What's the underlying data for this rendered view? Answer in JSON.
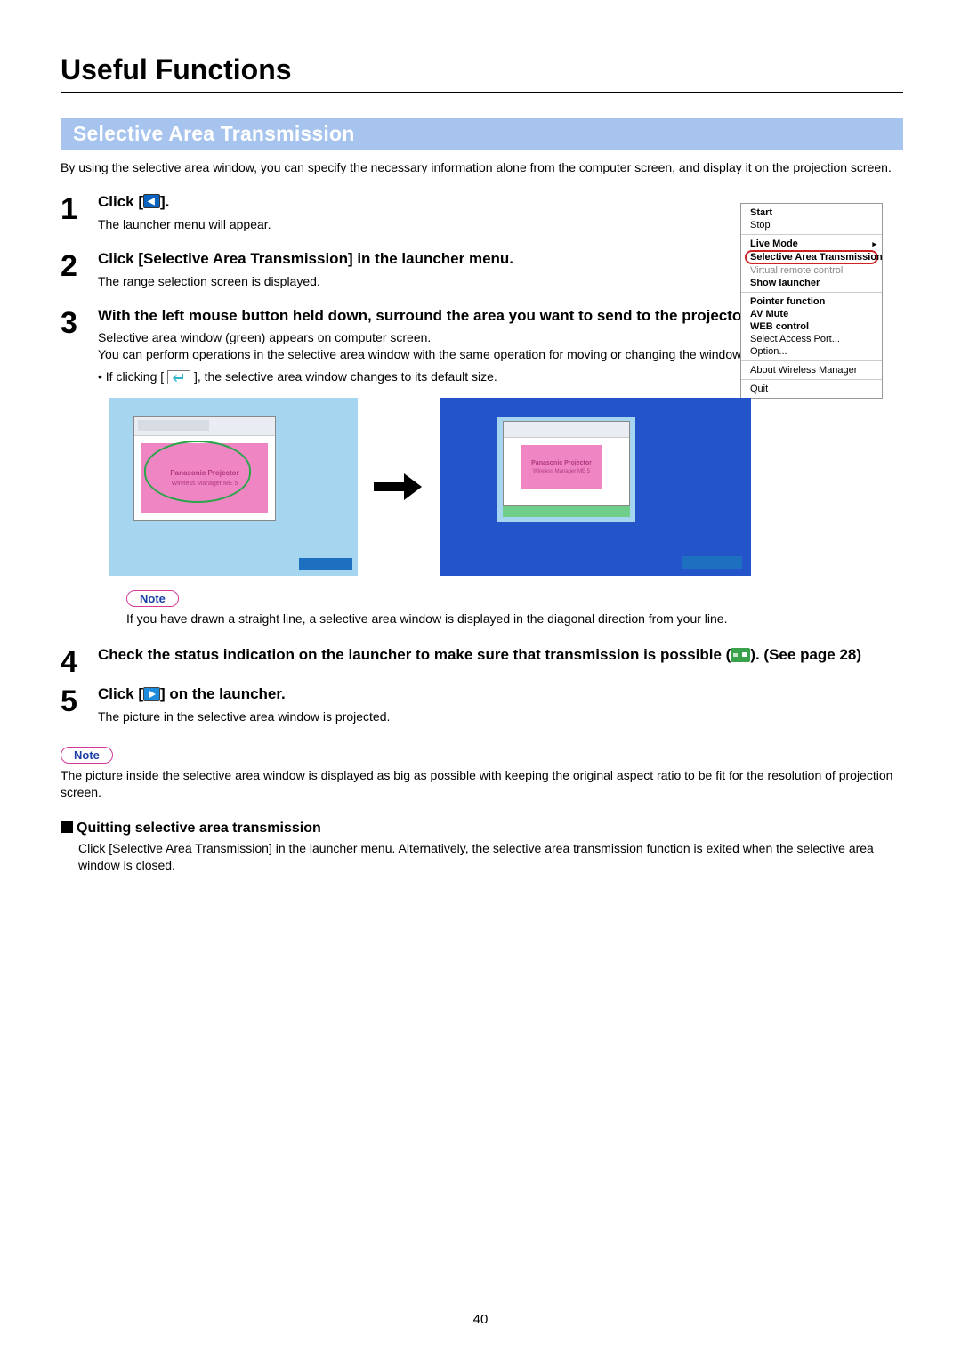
{
  "page": {
    "title": "Useful Functions",
    "section": "Selective Area Transmission",
    "intro": "By using the selective area window, you can specify the necessary information alone from the computer screen, and display it on the projection screen.",
    "page_number": "40"
  },
  "steps": {
    "s1": {
      "num": "1",
      "head_a": "Click [",
      "head_b": "].",
      "desc": "The launcher menu will appear."
    },
    "s2": {
      "num": "2",
      "head": "Click [Selective Area Transmission] in the launcher menu.",
      "desc": "The range selection screen is displayed."
    },
    "s3": {
      "num": "3",
      "head": "With the left mouse button held down, surround the area you want to send to the projector.",
      "desc1": "Selective area window (green) appears on computer screen.",
      "desc2": "You can perform operations in the selective area window with the same operation for moving or changing the window on the computer screen.",
      "bullet_a": "• If clicking [",
      "bullet_b": "], the selective area window changes to its default size.",
      "note": "If you have drawn a straight line, a selective area window is displayed in the diagonal direction from your line."
    },
    "s4": {
      "num": "4",
      "head_a": "Check the status indication on the launcher to make sure that transmission is possible (",
      "head_b": "). (See page 28)"
    },
    "s5": {
      "num": "5",
      "head_a": "Click [",
      "head_b": "] on the launcher.",
      "desc": "The picture in the selective area window is projected."
    }
  },
  "notes": {
    "label": "Note",
    "bottom": "The picture inside the selective area window is displayed as big as possible with keeping the original aspect ratio to be fit for the resolution of projection screen."
  },
  "quitting": {
    "head": "Quitting selective area transmission",
    "body": "Click [Selective Area Transmission]  in the launcher menu. Alternatively, the selective area transmission function is exited when the selective area window is closed."
  },
  "launcher_menu": {
    "start": "Start",
    "stop": "Stop",
    "live_mode": "Live Mode",
    "sel_area": "Selective Area Transmission",
    "vrc": "Virtual remote control",
    "show_launcher": "Show launcher",
    "pointer": "Pointer function",
    "av_mute": "AV Mute",
    "web": "WEB control",
    "sap": "Select Access Port...",
    "option": "Option...",
    "about": "About Wireless Manager",
    "quit": "Quit"
  },
  "illus": {
    "brand": "Panasonic Projector",
    "prod": "Wireless Manager ME 5"
  }
}
